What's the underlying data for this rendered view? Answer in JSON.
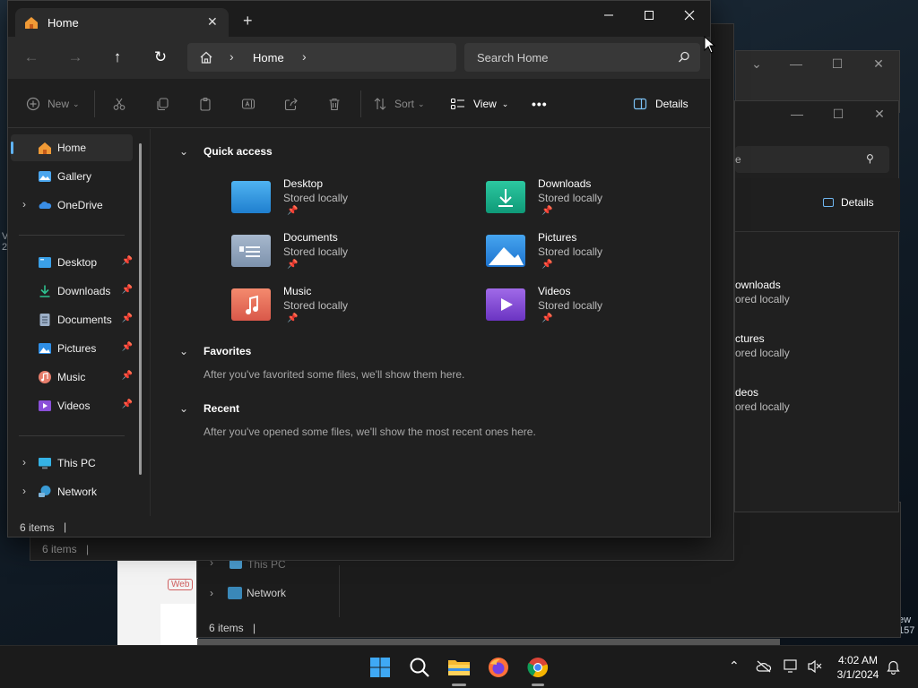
{
  "window": {
    "tab_title": "Home",
    "new_tab": "+",
    "close_tab": "✕"
  },
  "nav": {
    "breadcrumb_location": "Home",
    "search_placeholder": "Search Home"
  },
  "toolbar": {
    "new_label": "New",
    "sort_label": "Sort",
    "view_label": "View",
    "more_label": "•••",
    "details_label": "Details"
  },
  "sidebar": {
    "top_items": [
      {
        "label": "Home",
        "icon": "home-icon"
      },
      {
        "label": "Gallery",
        "icon": "gallery-icon"
      },
      {
        "label": "OneDrive",
        "icon": "onedrive-icon"
      }
    ],
    "pinned_items": [
      {
        "label": "Desktop",
        "icon": "desktop-folder-icon"
      },
      {
        "label": "Downloads",
        "icon": "downloads-folder-icon"
      },
      {
        "label": "Documents",
        "icon": "documents-folder-icon"
      },
      {
        "label": "Pictures",
        "icon": "pictures-folder-icon"
      },
      {
        "label": "Music",
        "icon": "music-folder-icon"
      },
      {
        "label": "Videos",
        "icon": "videos-folder-icon"
      }
    ],
    "bottom_items": [
      {
        "label": "This PC",
        "icon": "this-pc-icon"
      },
      {
        "label": "Network",
        "icon": "network-icon"
      }
    ]
  },
  "content": {
    "quick_access_title": "Quick access",
    "quick_access": [
      {
        "name": "Desktop",
        "status": "Stored locally",
        "color": "#3aa0e8"
      },
      {
        "name": "Downloads",
        "status": "Stored locally",
        "color": "#1bb28c"
      },
      {
        "name": "Documents",
        "status": "Stored locally",
        "color": "#8ea4bf"
      },
      {
        "name": "Pictures",
        "status": "Stored locally",
        "color": "#2f8fe6"
      },
      {
        "name": "Music",
        "status": "Stored locally",
        "color": "#e2725b"
      },
      {
        "name": "Videos",
        "status": "Stored locally",
        "color": "#8a4fd8"
      }
    ],
    "favorites_title": "Favorites",
    "favorites_hint": "After you've favorited some files, we'll show them here.",
    "recent_title": "Recent",
    "recent_hint": "After you've opened some files, we'll show the most recent ones here."
  },
  "status": {
    "item_count": "6 items"
  },
  "background_windows": {
    "win2_status": "6 items",
    "win2_details": "Details",
    "win2_items": [
      {
        "name": "ownloads",
        "status": "ored locally"
      },
      {
        "name": "ctures",
        "status": "ored locally"
      },
      {
        "name": "deos",
        "status": "ored locally"
      }
    ],
    "win2_search_fragment": "e",
    "win3_status": "6 items",
    "win3_this_pc": "This PC",
    "win3_network": "Network",
    "edge_text_1": "ew",
    "edge_text_2": "157",
    "web_fragment": "Web"
  },
  "taskbar": {
    "time": "4:02 AM",
    "date": "3/1/2024"
  }
}
